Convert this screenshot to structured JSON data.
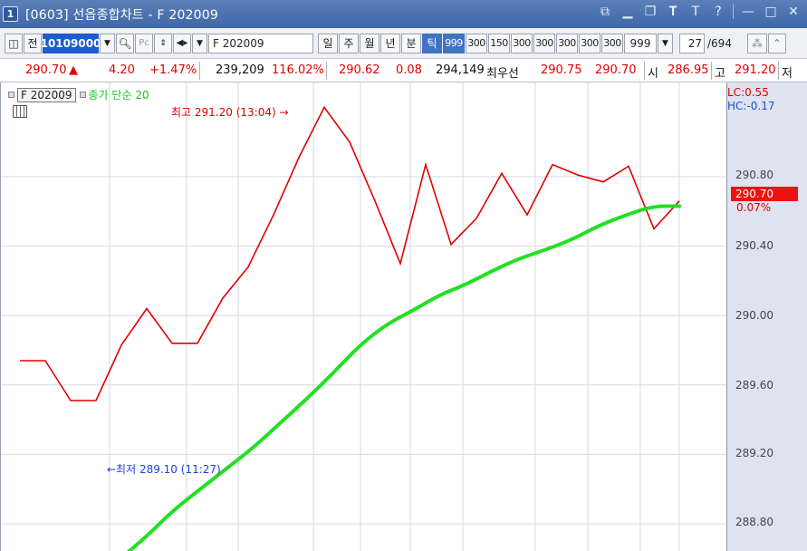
{
  "window": {
    "num": "1",
    "title": "[0603] 선옵종합차트 - F 202009"
  },
  "toolbar": {
    "jeon": "전",
    "code": "10109000",
    "name": "F 202009",
    "periods": [
      "일",
      "주",
      "월",
      "년",
      "분",
      "틱"
    ],
    "active_period": "틱",
    "intervals": [
      "999",
      "300",
      "150",
      "300",
      "300",
      "300",
      "300",
      "300"
    ],
    "count": "999",
    "page": "27",
    "total": "/694"
  },
  "quote": {
    "price": "290.70",
    "arrow": "▲",
    "change": "4.20",
    "change_pct": "+1.47%",
    "volume": "239,209",
    "volume_pct": "116.02%",
    "basis": "290.62",
    "basis_diff": "0.08",
    "open_interest": "294,149",
    "best_label": "최우선",
    "best_ask": "290.75",
    "best_bid": "290.70",
    "open_label": "시",
    "open": "286.95",
    "high_label": "고",
    "high": "291.20",
    "low_label": "저"
  },
  "chart": {
    "legend_name": "F 202009",
    "legend_ma": "종가 단순 20",
    "lc": "LC:0.55",
    "hc": "HC:-0.17",
    "current_price": "290.70",
    "current_pct": "0.07%",
    "high_note": "최고 291.20 (13:04) →",
    "low_note": "←최저 289.10 (11:27)",
    "colors": {
      "price": "#e00000",
      "ma": "#22e022",
      "grid": "#d6d8e0"
    }
  },
  "chart_data": {
    "type": "line",
    "y_ticks": [
      "290.80",
      "290.40",
      "290.00",
      "289.60",
      "289.20",
      "288.80"
    ],
    "ylim": [
      288.65,
      291.3
    ],
    "series": [
      {
        "name": "F 202009",
        "values": [
          289.74,
          289.74,
          289.51,
          289.51,
          289.83,
          290.04,
          289.84,
          289.84,
          290.1,
          290.28,
          290.58,
          290.91,
          291.2,
          291.0,
          290.66,
          290.3,
          290.87,
          290.41,
          290.56,
          290.82,
          290.58,
          290.87,
          290.81,
          290.77,
          290.86,
          290.5,
          290.66
        ]
      },
      {
        "name": "종가 단순 20",
        "values": [
          288.6,
          288.73,
          288.88,
          289.0,
          289.12,
          289.24,
          289.38,
          289.52,
          289.67,
          289.83,
          289.95,
          290.03,
          290.12,
          290.18,
          290.26,
          290.33,
          290.38,
          290.44,
          290.52,
          290.58,
          290.63,
          290.63
        ]
      }
    ]
  }
}
